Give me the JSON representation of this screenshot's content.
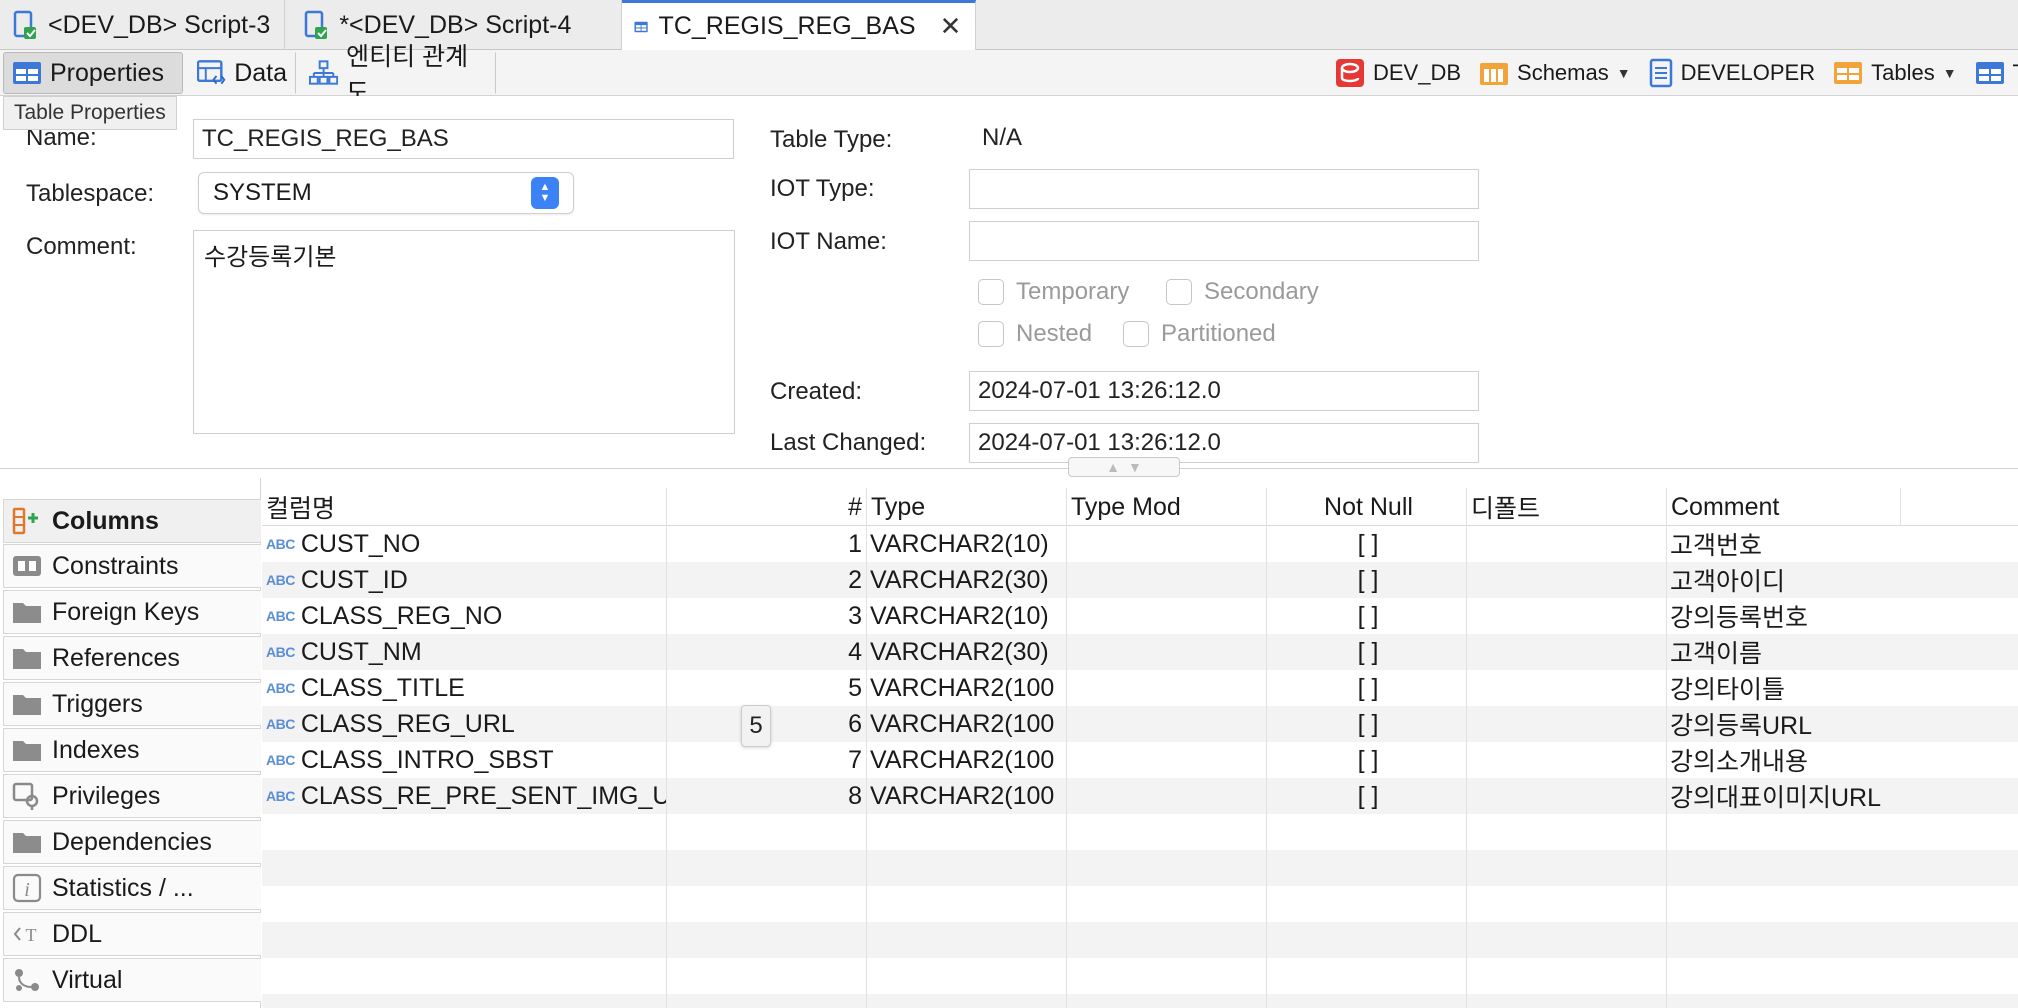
{
  "editor_tabs": [
    {
      "label": "<DEV_DB> Script-3",
      "icon": "sql-script-icon"
    },
    {
      "label": "*<DEV_DB> Script-4",
      "icon": "sql-script-icon"
    },
    {
      "label": "TC_REGIS_REG_BAS",
      "icon": "table-icon",
      "active": true
    }
  ],
  "sub_tabs": [
    {
      "label": "Properties",
      "icon": "table-icon",
      "active": true
    },
    {
      "label": "Data",
      "icon": "data-grid-icon"
    },
    {
      "label": "엔티티 관계도",
      "icon": "diagram-icon"
    }
  ],
  "breadcrumbs": {
    "connection": "DEV_DB",
    "schemas": "Schemas",
    "schema": "DEVELOPER",
    "tables": "Tables",
    "trailing": "T"
  },
  "tooltip": "Table Properties",
  "form": {
    "name_label": "Name:",
    "name_value": "TC_REGIS_REG_BAS",
    "tablespace_label": "Tablespace:",
    "tablespace_value": "SYSTEM",
    "comment_label": "Comment:",
    "comment_value": "수강등록기본",
    "table_type_label": "Table Type:",
    "table_type_value": "N/A",
    "iot_type_label": "IOT Type:",
    "iot_type_value": "",
    "iot_name_label": "IOT Name:",
    "iot_name_value": "",
    "checkboxes": {
      "temporary": "Temporary",
      "secondary": "Secondary",
      "nested": "Nested",
      "partitioned": "Partitioned"
    },
    "created_label": "Created:",
    "created_value": "2024-07-01 13:26:12.0",
    "last_changed_label": "Last Changed:",
    "last_changed_value": "2024-07-01 13:26:12.0"
  },
  "nav_items": [
    {
      "label": "Columns",
      "icon": "columns-icon",
      "active": true
    },
    {
      "label": "Constraints",
      "icon": "constraint-icon"
    },
    {
      "label": "Foreign Keys",
      "icon": "folder-icon"
    },
    {
      "label": "References",
      "icon": "folder-icon"
    },
    {
      "label": "Triggers",
      "icon": "folder-icon"
    },
    {
      "label": "Indexes",
      "icon": "folder-icon"
    },
    {
      "label": "Privileges",
      "icon": "privileges-icon"
    },
    {
      "label": "Dependencies",
      "icon": "folder-icon"
    },
    {
      "label": "Statistics / ...",
      "icon": "info-icon"
    },
    {
      "label": "DDL",
      "icon": "ddl-icon"
    },
    {
      "label": "Virtual",
      "icon": "virtual-icon"
    }
  ],
  "columns_table": {
    "headers": {
      "name": "컬럼명",
      "num": "#",
      "type": "Type",
      "type_mod": "Type Mod",
      "not_null": "Not Null",
      "default": "디폴트",
      "comment": "Comment"
    },
    "type_badge": "ABC",
    "rows": [
      {
        "name": "CUST_NO",
        "num": "1",
        "type": "VARCHAR2(10)",
        "type_mod": "",
        "not_null": "[ ]",
        "default": "",
        "comment": "고객번호"
      },
      {
        "name": "CUST_ID",
        "num": "2",
        "type": "VARCHAR2(30)",
        "type_mod": "",
        "not_null": "[ ]",
        "default": "",
        "comment": "고객아이디"
      },
      {
        "name": "CLASS_REG_NO",
        "num": "3",
        "type": "VARCHAR2(10)",
        "type_mod": "",
        "not_null": "[ ]",
        "default": "",
        "comment": "강의등록번호"
      },
      {
        "name": "CUST_NM",
        "num": "4",
        "type": "VARCHAR2(30)",
        "type_mod": "",
        "not_null": "[ ]",
        "default": "",
        "comment": "고객이름"
      },
      {
        "name": "CLASS_TITLE",
        "num": "5",
        "type": "VARCHAR2(100",
        "type_mod": "",
        "not_null": "[ ]",
        "default": "",
        "comment": "강의타이틀"
      },
      {
        "name": "CLASS_REG_URL",
        "num": "6",
        "type": "VARCHAR2(100",
        "type_mod": "",
        "not_null": "[ ]",
        "default": "",
        "comment": "강의등록URL"
      },
      {
        "name": "CLASS_INTRO_SBST",
        "num": "7",
        "type": "VARCHAR2(100",
        "type_mod": "",
        "not_null": "[ ]",
        "default": "",
        "comment": "강의소개내용"
      },
      {
        "name": "CLASS_RE_PRE_SENT_IMG_U",
        "num": "8",
        "type": "VARCHAR2(100",
        "type_mod": "",
        "not_null": "[ ]",
        "default": "",
        "comment": "강의대표이미지URL"
      }
    ]
  },
  "cell_popup": "5"
}
